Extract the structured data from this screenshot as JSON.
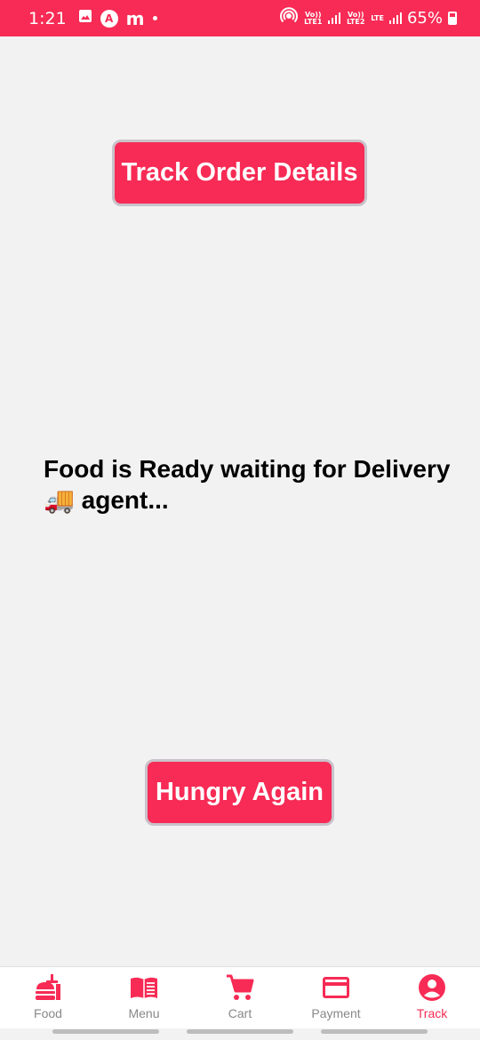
{
  "status_bar": {
    "time": "1:21",
    "sim1_label": "Vo)) LTE1",
    "sim2_label": "Vo)) LTE2",
    "lte_label": "LTE",
    "battery": "65%"
  },
  "track_details_button": "Track Order Details",
  "status_message": {
    "line1": "Food is Ready waiting for Delivery",
    "emoji": "🚚",
    "line2": "agent..."
  },
  "hungry_button": "Hungry Again",
  "bottom_nav": {
    "items": [
      {
        "label": "Food",
        "icon": "food-icon"
      },
      {
        "label": "Menu",
        "icon": "menu-book-icon"
      },
      {
        "label": "Cart",
        "icon": "cart-icon"
      },
      {
        "label": "Payment",
        "icon": "payment-card-icon"
      },
      {
        "label": "Track",
        "icon": "account-circle-icon",
        "active": true
      }
    ]
  },
  "colors": {
    "accent": "#f72b55",
    "background": "#f2f2f2"
  }
}
